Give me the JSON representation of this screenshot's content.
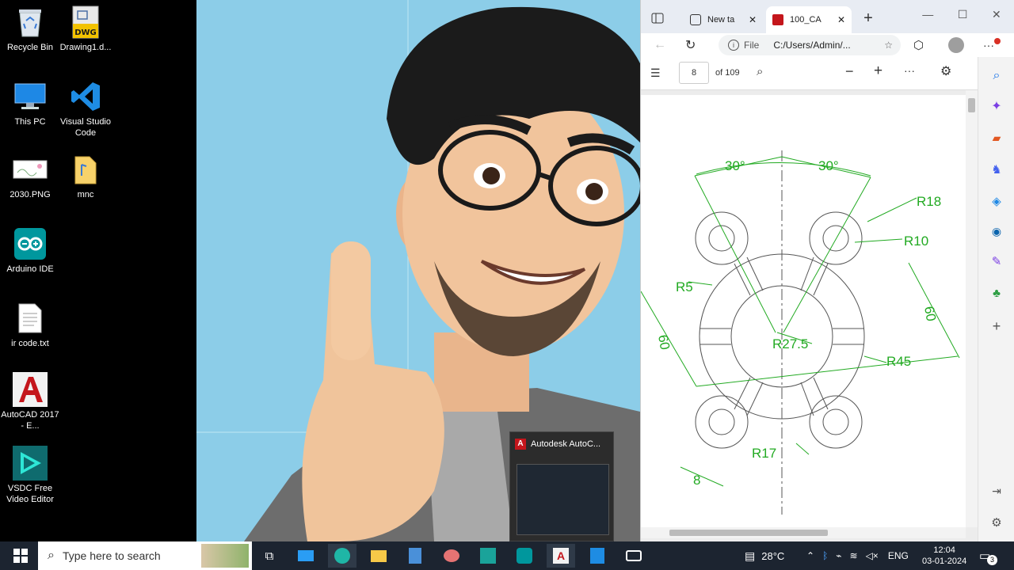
{
  "desktop": {
    "icons": [
      {
        "label": "Recycle Bin",
        "icon": "recycle-bin-icon"
      },
      {
        "label": "Drawing1.d...",
        "icon": "dwg-file-icon",
        "badge": "DWG"
      },
      {
        "label": "This PC",
        "icon": "this-pc-icon"
      },
      {
        "label": "Visual Studio Code",
        "icon": "vscode-icon"
      },
      {
        "label": "2030.PNG",
        "icon": "image-file-icon"
      },
      {
        "label": "mnc",
        "icon": "folder-icon"
      },
      {
        "label": "Arduino IDE",
        "icon": "arduino-icon"
      },
      {
        "label": "ir code.txt",
        "icon": "text-file-icon"
      },
      {
        "label": "AutoCAD 2017 - E...",
        "icon": "autocad-icon"
      },
      {
        "label": "VSDC Free Video Editor",
        "icon": "vsdc-icon"
      }
    ]
  },
  "preview": {
    "title": "Autodesk AutoC..."
  },
  "browser": {
    "tabs": [
      {
        "label": "New ta",
        "icon": "new-tab-page-icon"
      },
      {
        "label": "100_CA",
        "icon": "pdf-icon"
      }
    ],
    "address": {
      "scheme": "File",
      "url": "C:/Users/Admin/..."
    },
    "pdf": {
      "page_number": "8",
      "page_total": "of 109"
    },
    "drawing": {
      "dims": [
        "30°",
        "30°",
        "R18",
        "R10",
        "R5",
        "60",
        "60",
        "R27.5",
        "R45",
        "R17",
        "8"
      ],
      "line_color": "#555555",
      "dim_color": "#22aa22"
    }
  },
  "taskbar": {
    "search_placeholder": "Type here to search",
    "weather": "28°C",
    "language": "ENG",
    "time": "12:04",
    "date": "03-01-2024",
    "notification_count": "3",
    "colors": {
      "background": "#1c2430",
      "search_bg": "#ffffff"
    }
  }
}
